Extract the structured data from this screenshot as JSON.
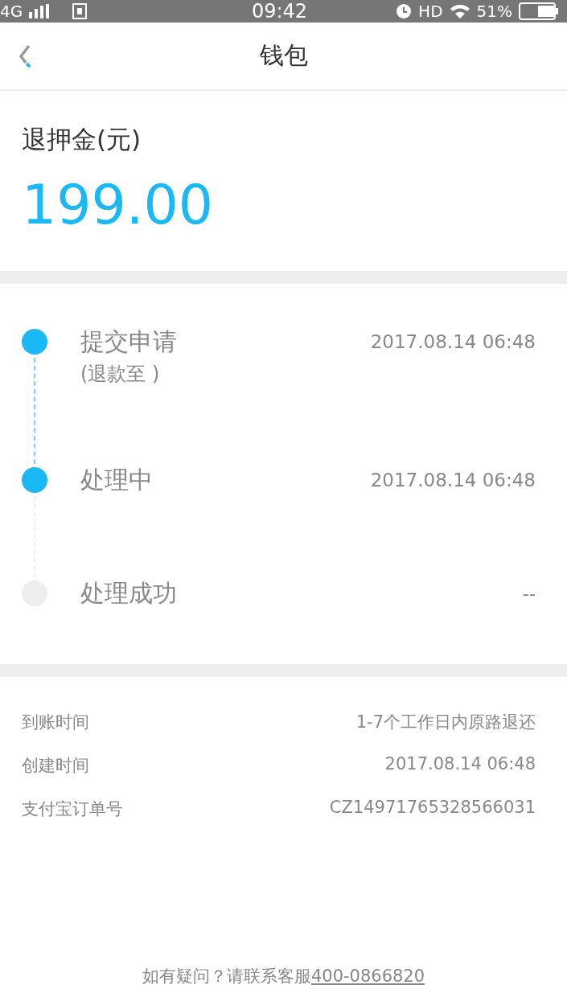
{
  "status_bar": {
    "network": "4G",
    "time": "09:42",
    "hd": "HD",
    "battery": "51%"
  },
  "header": {
    "title": "钱包"
  },
  "refund": {
    "label": "退押金(元)",
    "amount": "199.00"
  },
  "steps": [
    {
      "title": "提交申请",
      "note": "(退款至 )",
      "time": "2017.08.14 06:48",
      "done": true
    },
    {
      "title": "处理中",
      "time": "2017.08.14 06:48",
      "done": true
    },
    {
      "title": "处理成功",
      "time": "--",
      "done": false
    }
  ],
  "details": [
    {
      "label": "到账时间",
      "value": "1-7个工作日内原路退还"
    },
    {
      "label": "创建时间",
      "value": "2017.08.14 06:48"
    },
    {
      "label": "支付宝订单号",
      "value": "CZ14971765328566031"
    }
  ],
  "footer": {
    "text": "如有疑问？请联系客服",
    "phone": "400-0866820"
  }
}
